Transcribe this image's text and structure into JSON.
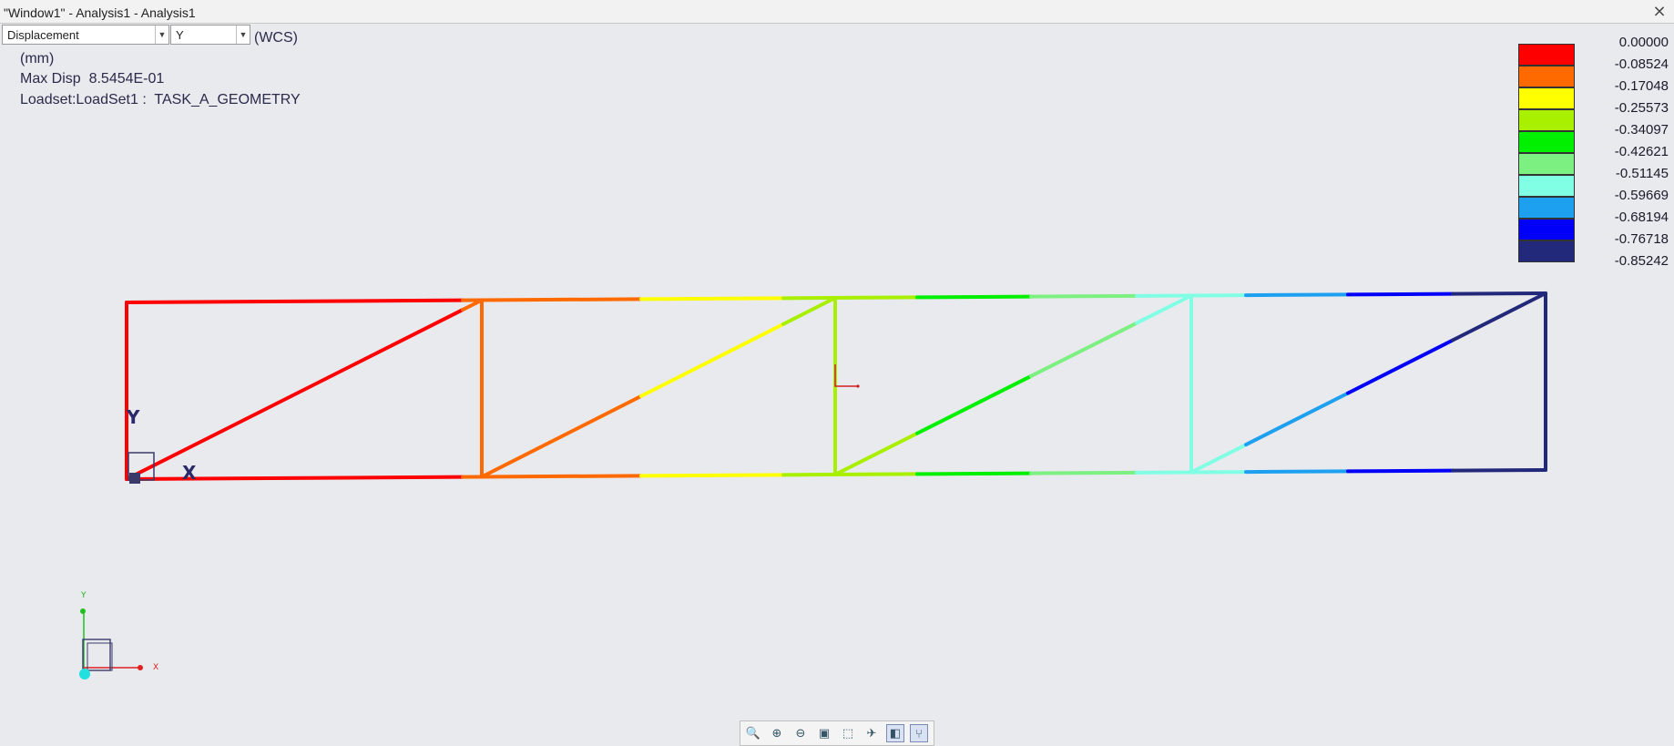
{
  "window": {
    "title": "\"Window1\" - Analysis1 - Analysis1",
    "close_glyph": "⨯"
  },
  "controls": {
    "quantity": "Displacement",
    "component": "Y",
    "coord_system": "(WCS)"
  },
  "info": {
    "units": "(mm)",
    "max_disp": "Max Disp  8.5454E-01",
    "loadset": "Loadset:LoadSet1 :  TASK_A_GEOMETRY"
  },
  "legend": {
    "colors": [
      "#ff0000",
      "#ff6a00",
      "#ffff00",
      "#a8f000",
      "#00f000",
      "#7cf080",
      "#80ffe4",
      "#1ea0f0",
      "#0000f8",
      "#22287a"
    ],
    "labels": [
      "0.00000",
      "-0.08524",
      "-0.17048",
      "-0.25573",
      "-0.34097",
      "-0.42621",
      "-0.51145",
      "-0.59669",
      "-0.68194",
      "-0.76718",
      "-0.85242"
    ]
  },
  "model": {
    "wcs_label_y": "Y",
    "wcs_label_x": "X",
    "triad_y": "Y",
    "triad_x": "X"
  },
  "toolbar": {
    "icons": [
      "zoom-fit-icon",
      "zoom-in-icon",
      "zoom-out-icon",
      "repaint-icon",
      "orient-icon",
      "view-manager-icon",
      "display-style-icon",
      "model-tree-icon"
    ],
    "glyphs": [
      "🔍",
      "⊕",
      "⊖",
      "▣",
      "⬚",
      "✈",
      "◧",
      "⑂"
    ]
  },
  "colors": {
    "background": "#e8eaee"
  }
}
